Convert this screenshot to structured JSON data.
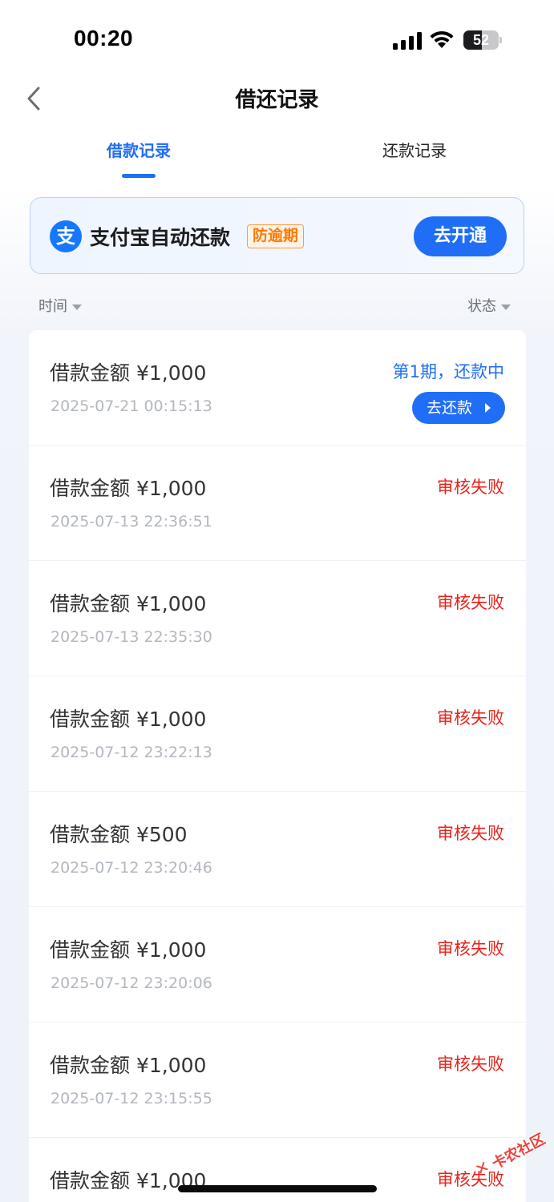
{
  "status_bar": {
    "time": "00:20",
    "battery": "52",
    "battery_level": 0.52
  },
  "nav": {
    "title": "借还记录"
  },
  "tabs": [
    {
      "label": "借款记录",
      "active": true
    },
    {
      "label": "还款记录",
      "active": false
    }
  ],
  "banner": {
    "icon_glyph": "支",
    "title": "支付宝自动还款",
    "tag": "防逾期",
    "button": "去开通"
  },
  "filters": {
    "time": "时间",
    "status": "状态"
  },
  "records": [
    {
      "amount": "借款金额 ¥1,000",
      "time": "2025-07-21 00:15:13",
      "status": "第1期，还款中",
      "state": "active",
      "action": "去还款"
    },
    {
      "amount": "借款金额 ¥1,000",
      "time": "2025-07-13 22:36:51",
      "status": "审核失败",
      "state": "fail"
    },
    {
      "amount": "借款金额 ¥1,000",
      "time": "2025-07-13 22:35:30",
      "status": "审核失败",
      "state": "fail"
    },
    {
      "amount": "借款金额 ¥1,000",
      "time": "2025-07-12 23:22:13",
      "status": "审核失败",
      "state": "fail"
    },
    {
      "amount": "借款金额 ¥500",
      "time": "2025-07-12 23:20:46",
      "status": "审核失败",
      "state": "fail"
    },
    {
      "amount": "借款金额 ¥1,000",
      "time": "2025-07-12 23:20:06",
      "status": "审核失败",
      "state": "fail"
    },
    {
      "amount": "借款金额 ¥1,000",
      "time": "2025-07-12 23:15:55",
      "status": "审核失败",
      "state": "fail"
    },
    {
      "amount": "借款金额 ¥1,000",
      "time": "",
      "status": "审核失败",
      "state": "fail"
    }
  ],
  "watermark": "卡农社区",
  "colors": {
    "accent": "#1f6ef5",
    "fail": "#e8221b",
    "tag": "#ff7a00"
  }
}
